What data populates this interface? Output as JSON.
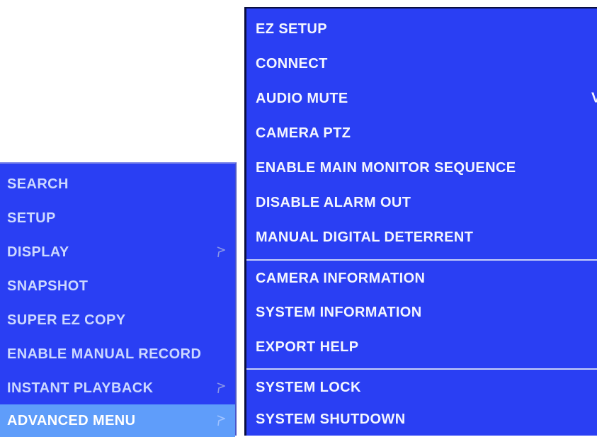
{
  "colors": {
    "menu_background": "#2a3ff3",
    "highlight": "#5f9dfa",
    "left_text": "#ccd8ff",
    "right_text": "#f4f6ff",
    "divider": "#c7cff8"
  },
  "main_menu": {
    "items": [
      {
        "label": "SEARCH",
        "submenu": false
      },
      {
        "label": "SETUP",
        "submenu": false
      },
      {
        "label": "DISPLAY",
        "submenu": true,
        "icon": "submenu-arrow-icon"
      },
      {
        "label": "SNAPSHOT",
        "submenu": false
      },
      {
        "label": "SUPER EZ COPY",
        "submenu": false
      },
      {
        "label": "ENABLE MANUAL RECORD",
        "submenu": false
      },
      {
        "label": "INSTANT PLAYBACK",
        "submenu": true,
        "icon": "submenu-arrow-icon"
      },
      {
        "label": "ADVANCED MENU",
        "submenu": true,
        "icon": "submenu-arrow-icon",
        "highlighted": true
      }
    ]
  },
  "advanced_menu": {
    "items": [
      {
        "label": "EZ SETUP"
      },
      {
        "label": "CONNECT"
      },
      {
        "label": "AUDIO MUTE",
        "trailing": "V"
      },
      {
        "label": "CAMERA PTZ"
      },
      {
        "label": "ENABLE MAIN MONITOR SEQUENCE"
      },
      {
        "label": "DISABLE ALARM OUT"
      },
      {
        "label": "MANUAL DIGITAL DETERRENT"
      },
      {
        "label": "CAMERA INFORMATION"
      },
      {
        "label": "SYSTEM INFORMATION"
      },
      {
        "label": "EXPORT HELP"
      },
      {
        "label": "SYSTEM LOCK"
      },
      {
        "label": "SYSTEM SHUTDOWN"
      }
    ]
  }
}
